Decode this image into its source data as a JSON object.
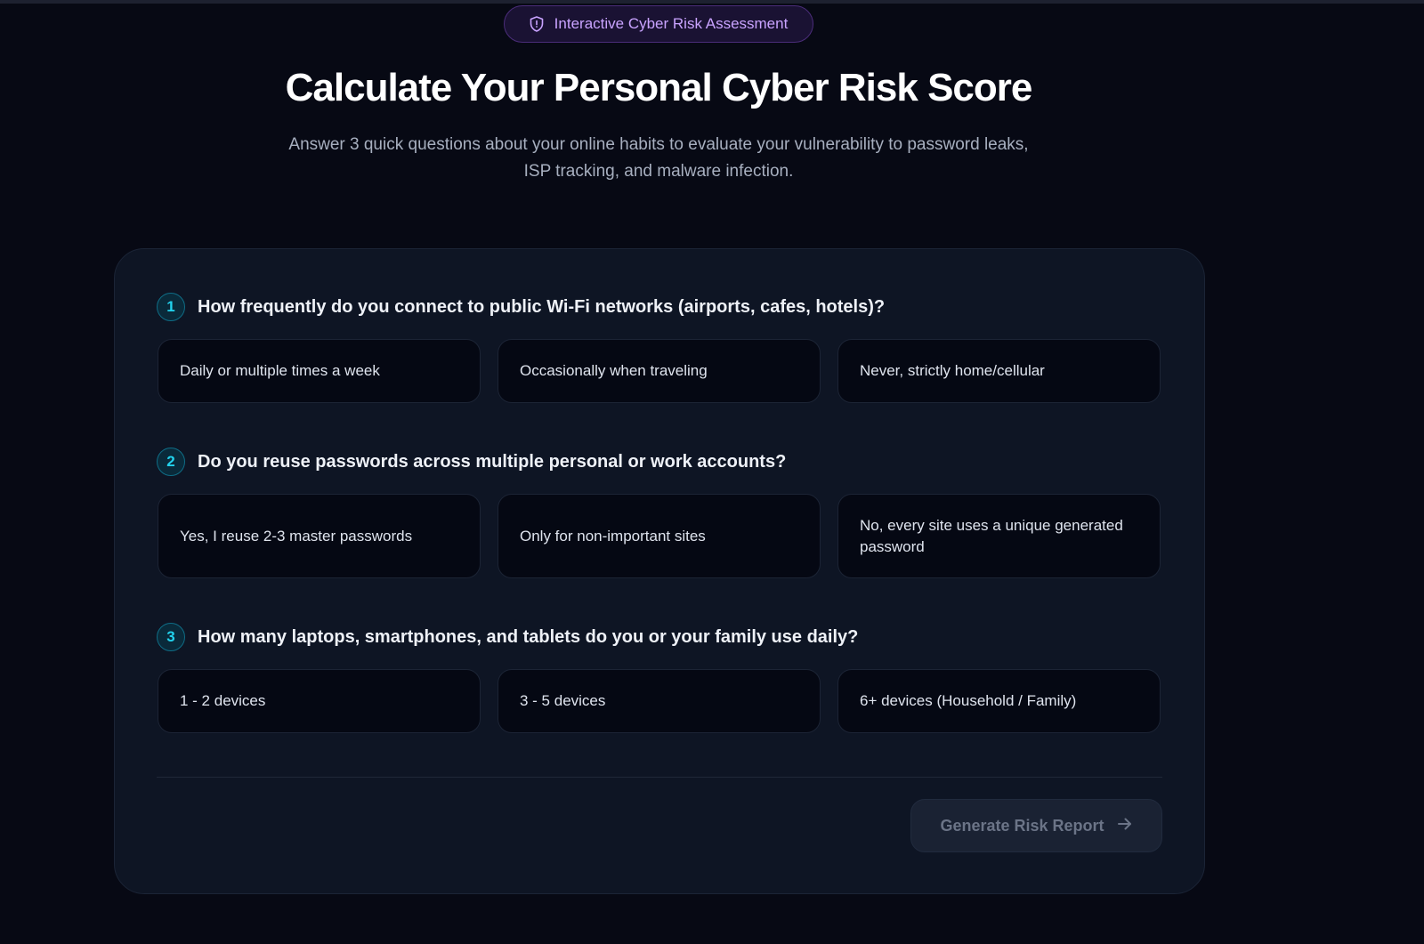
{
  "badge": {
    "label": "Interactive Cyber Risk Assessment",
    "icon": "shield-icon"
  },
  "hero": {
    "title": "Calculate Your Personal Cyber Risk Score",
    "subtitle": "Answer 3 quick questions about your online habits to evaluate your vulnerability to password leaks, ISP tracking, and malware infection."
  },
  "questions": [
    {
      "number": "1",
      "text": "How frequently do you connect to public Wi-Fi networks (airports, cafes, hotels)?",
      "options": [
        "Daily or multiple times a week",
        "Occasionally when traveling",
        "Never, strictly home/cellular"
      ]
    },
    {
      "number": "2",
      "text": "Do you reuse passwords across multiple personal or work accounts?",
      "options": [
        "Yes, I reuse 2-3 master passwords",
        "Only for non-important sites",
        "No, every site uses a unique generated password"
      ]
    },
    {
      "number": "3",
      "text": "How many laptops, smartphones, and tablets do you or your family use daily?",
      "options": [
        "1 - 2 devices",
        "3 - 5 devices",
        "6+ devices (Household / Family)"
      ]
    }
  ],
  "submit": {
    "label": "Generate Risk Report",
    "icon": "arrow-right-icon",
    "state": "disabled"
  },
  "colors": {
    "background": "#070914",
    "card": "#0e1524",
    "accent_cyan": "#22d3ee",
    "accent_purple": "#c9a3ff"
  }
}
